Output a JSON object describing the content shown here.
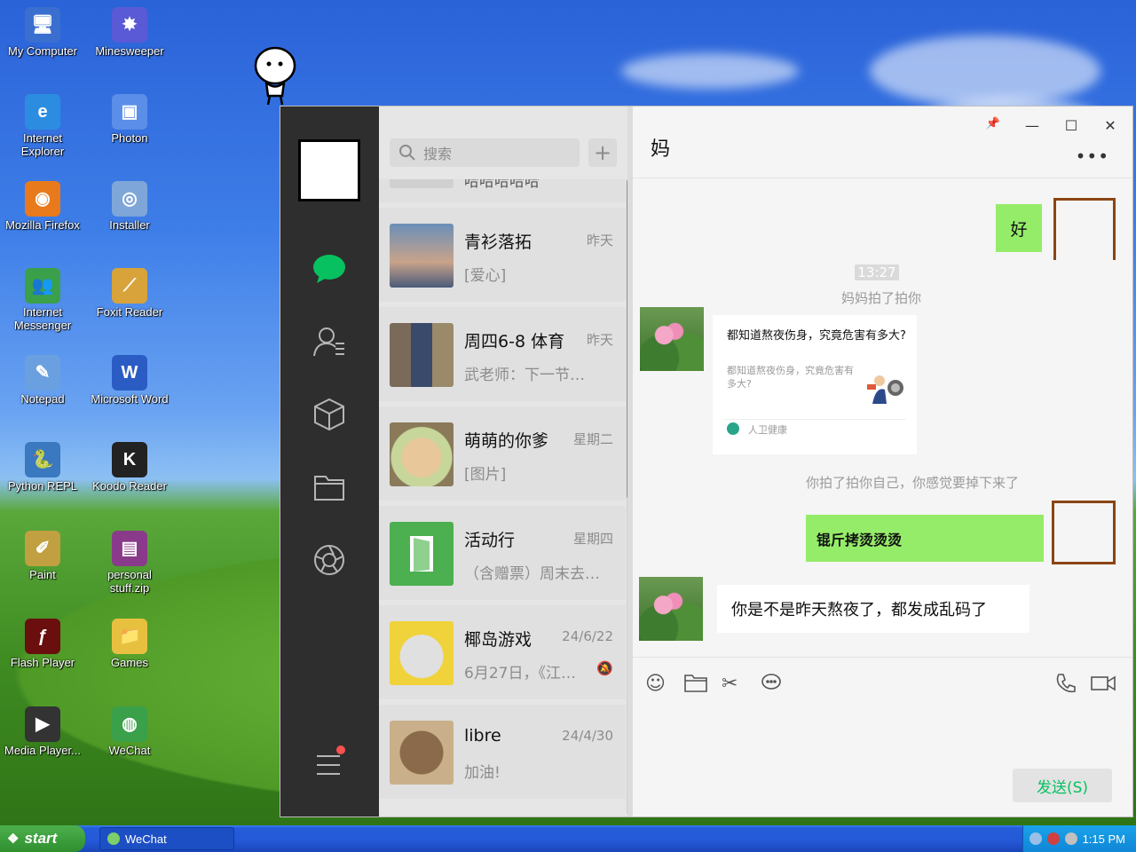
{
  "desktop": {
    "icons": [
      {
        "label": "My Computer",
        "glyph": "🖥",
        "color": "#3a6fd0"
      },
      {
        "label": "Minesweeper",
        "glyph": "✸",
        "color": "#5a5ad6"
      },
      {
        "label": "Internet Explorer",
        "glyph": "e",
        "color": "#2c8de0"
      },
      {
        "label": "Photon",
        "glyph": "▣",
        "color": "#5a8ee8"
      },
      {
        "label": "Mozilla Firefox",
        "glyph": "◉",
        "color": "#e87a1c"
      },
      {
        "label": "Installer",
        "glyph": "◎",
        "color": "#7ea6d8"
      },
      {
        "label": "Internet Messenger",
        "glyph": "👥",
        "color": "#3aa04a"
      },
      {
        "label": "Foxit Reader",
        "glyph": "⟋",
        "color": "#d8a33a"
      },
      {
        "label": "Notepad",
        "glyph": "✎",
        "color": "#6aa0e0"
      },
      {
        "label": "Microsoft Word",
        "glyph": "W",
        "color": "#2b5cc4"
      },
      {
        "label": "Python REPL",
        "glyph": "🐍",
        "color": "#3a78c0"
      },
      {
        "label": "Koodo Reader",
        "glyph": "K",
        "color": "#222222"
      },
      {
        "label": "Paint",
        "glyph": "✐",
        "color": "#c0a040"
      },
      {
        "label": "personal stuff.zip",
        "glyph": "▤",
        "color": "#8a3a8a"
      },
      {
        "label": "Flash Player",
        "glyph": "ƒ",
        "color": "#6a0e0e"
      },
      {
        "label": "Games",
        "glyph": "📁",
        "color": "#e8c040"
      },
      {
        "label": "Media Player...",
        "glyph": "▶",
        "color": "#333333"
      },
      {
        "label": "WeChat",
        "glyph": "◍",
        "color": "#3aa04a"
      }
    ]
  },
  "taskbar": {
    "start_label": "start",
    "task_label": "WeChat",
    "clock": "1:15 PM"
  },
  "wechat": {
    "search_placeholder": "搜索",
    "plus_label": "+",
    "conversations": [
      {
        "name": "",
        "preview": "哈哈哈哈哈",
        "time": "",
        "pic": "#bdbdbd"
      },
      {
        "name": "青衫落拓",
        "preview": "[爱心]",
        "time": "昨天",
        "pic": "#6b8fb8"
      },
      {
        "name": "周四6-8 体育",
        "preview": "武老师：下一节…",
        "time": "昨天",
        "pic": "#7a6a5a"
      },
      {
        "name": "萌萌的你爹",
        "preview": "[图片]",
        "time": "星期二",
        "pic": "#c9b98a"
      },
      {
        "name": "活动行",
        "preview": "（含赠票）周末去…",
        "time": "星期四",
        "pic": "#4caf50"
      },
      {
        "name": "椰岛游戏",
        "preview": "6月27日，《江…",
        "time": "24/6/22",
        "pic": "#f0d23a"
      },
      {
        "name": "libre",
        "preview": "加油!",
        "time": "24/4/30",
        "pic": "#8a6a4a"
      }
    ],
    "chat": {
      "title": "妈",
      "more": "•••",
      "win_controls": {
        "pin": "📌",
        "minimize": "—",
        "maximize": "☐",
        "close": "✕"
      },
      "msg_ok": "好",
      "time_stamp": "13:27",
      "pat_mom": "妈妈拍了拍你",
      "card_title": "都知道熬夜伤身，究竟危害有多大?",
      "card_desc": "都知道熬夜伤身，究竟危害有多大?",
      "card_source": "人卫健康",
      "pat_self": "你拍了拍你自己，你感觉要掉下来了",
      "msg_garbled": "锟斤拷烫烫烫",
      "msg_mom": "你是不是昨天熬夜了，都发成乱码了",
      "send_label": "发送(S)"
    }
  }
}
